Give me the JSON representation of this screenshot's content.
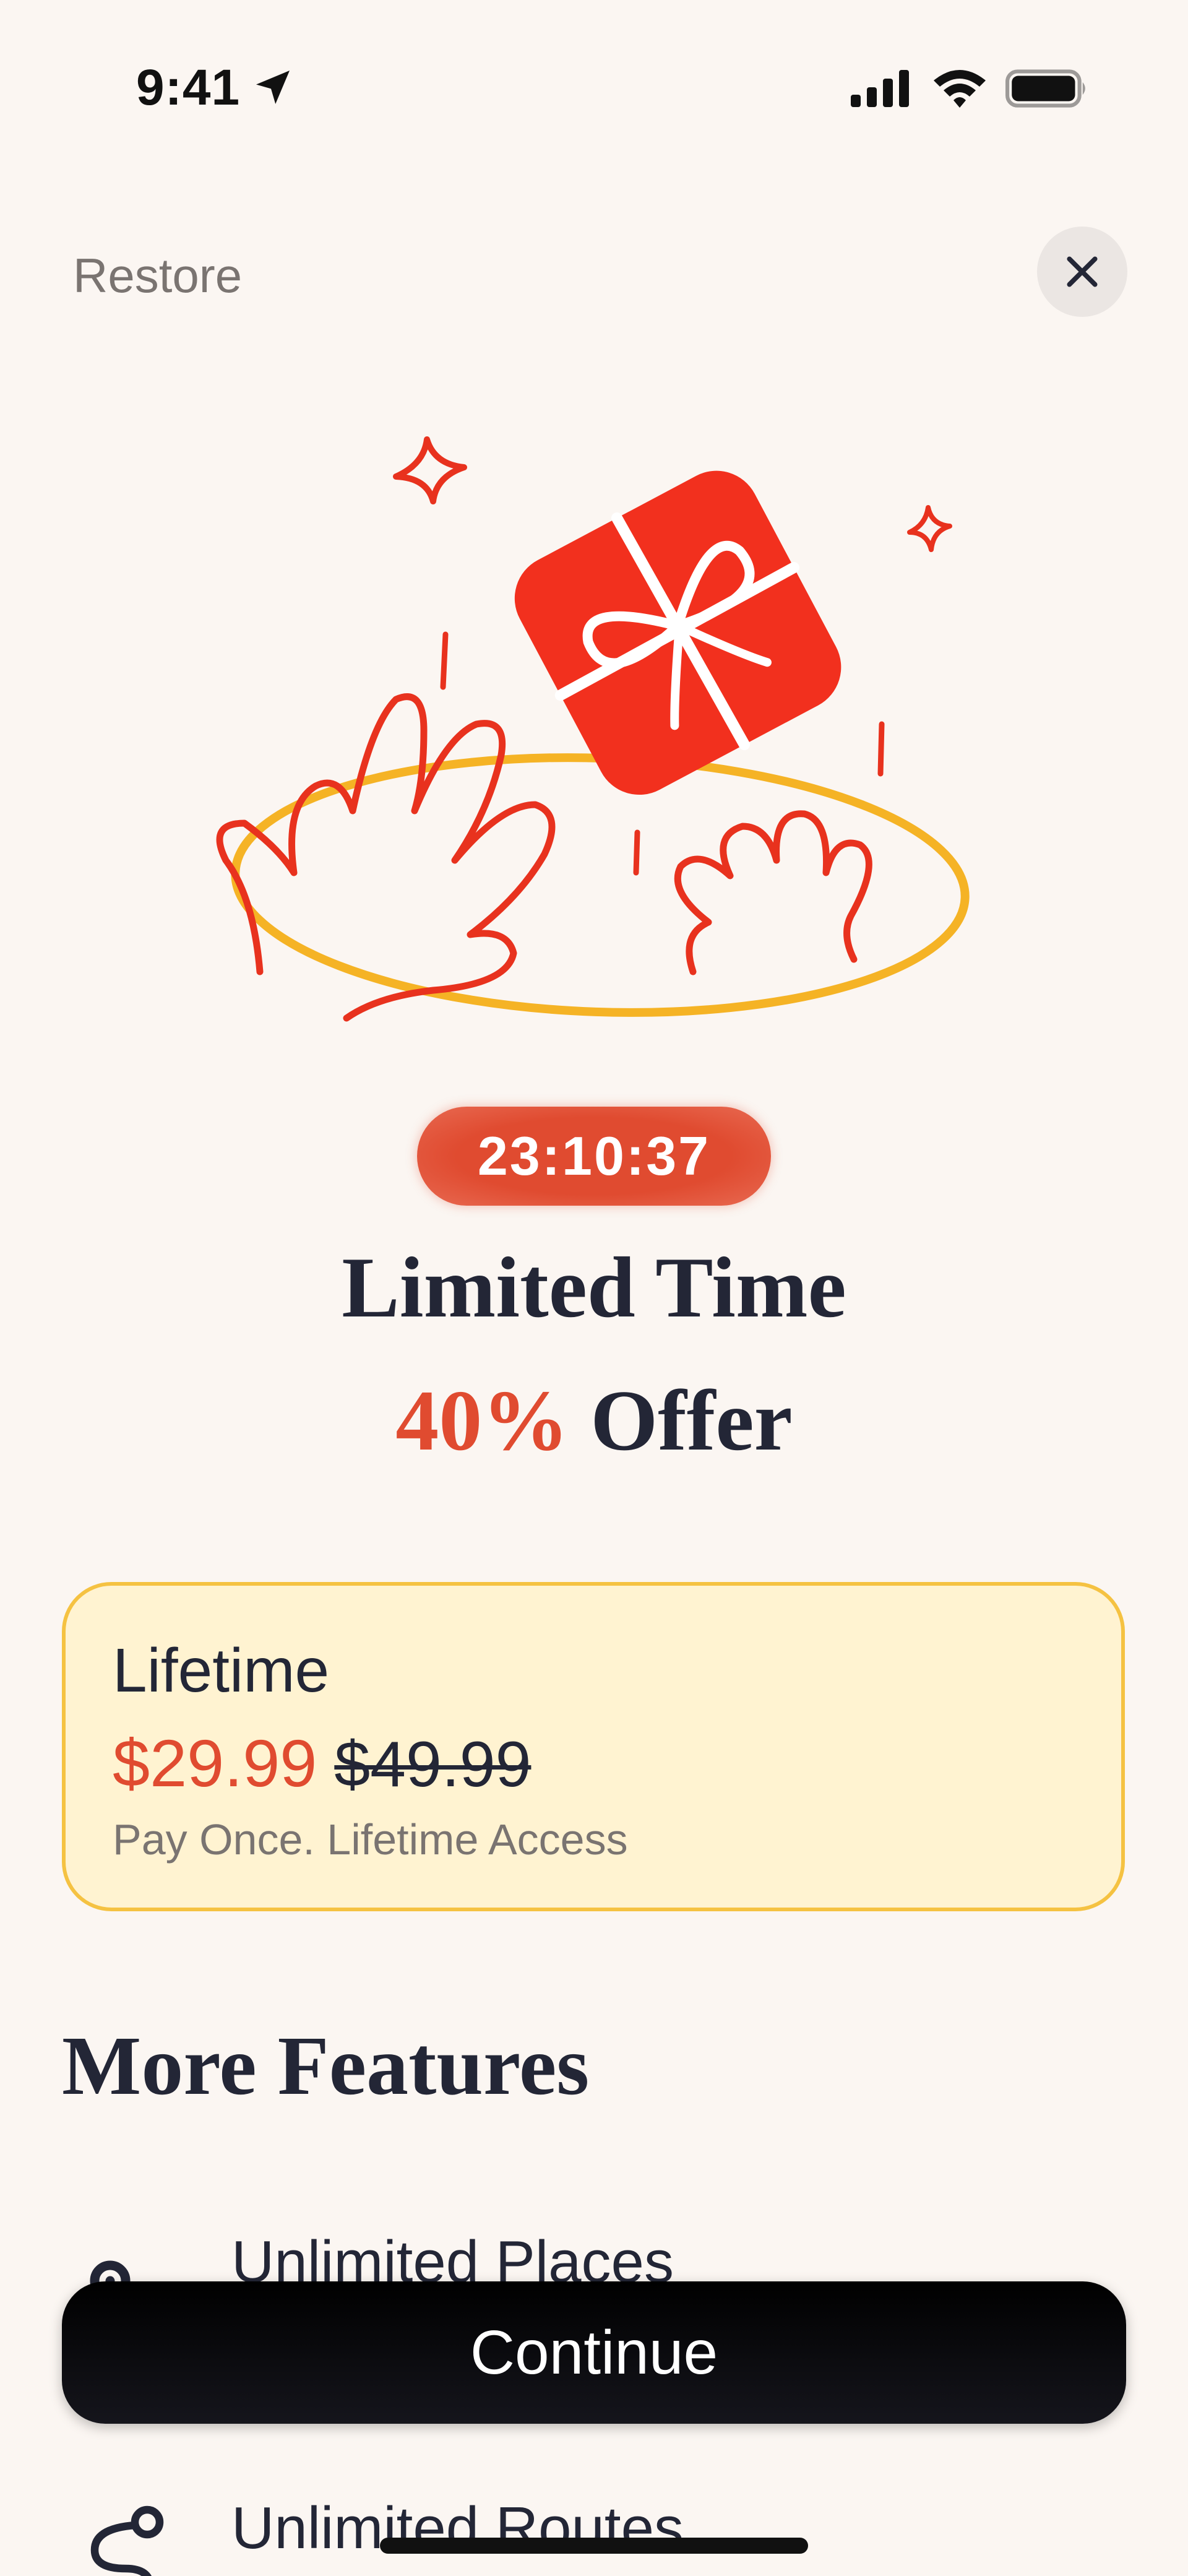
{
  "status_bar": {
    "time": "9:41"
  },
  "header": {
    "restore_label": "Restore",
    "close_icon": "close-icon"
  },
  "offer": {
    "countdown": "23:10:37",
    "headline_line1": "Limited Time",
    "discount": "40%",
    "headline_offer_word": "Offer"
  },
  "plan": {
    "name": "Lifetime",
    "price": "$29.99",
    "original_price": "$49.99",
    "description": "Pay Once. Lifetime Access"
  },
  "features": {
    "title": "More Features",
    "items": [
      {
        "label": "Unlimited Places",
        "icon": "map-pin-icon"
      },
      {
        "label": "Unlimited Routes",
        "icon": "route-icon"
      }
    ]
  },
  "cta": {
    "continue_label": "Continue"
  },
  "colors": {
    "background": "#fbf6f2",
    "accent": "#e04b30",
    "card_fill": "#fff3d1",
    "card_border": "#f5c242",
    "text_dark": "#232636",
    "text_muted": "#7a7471"
  }
}
